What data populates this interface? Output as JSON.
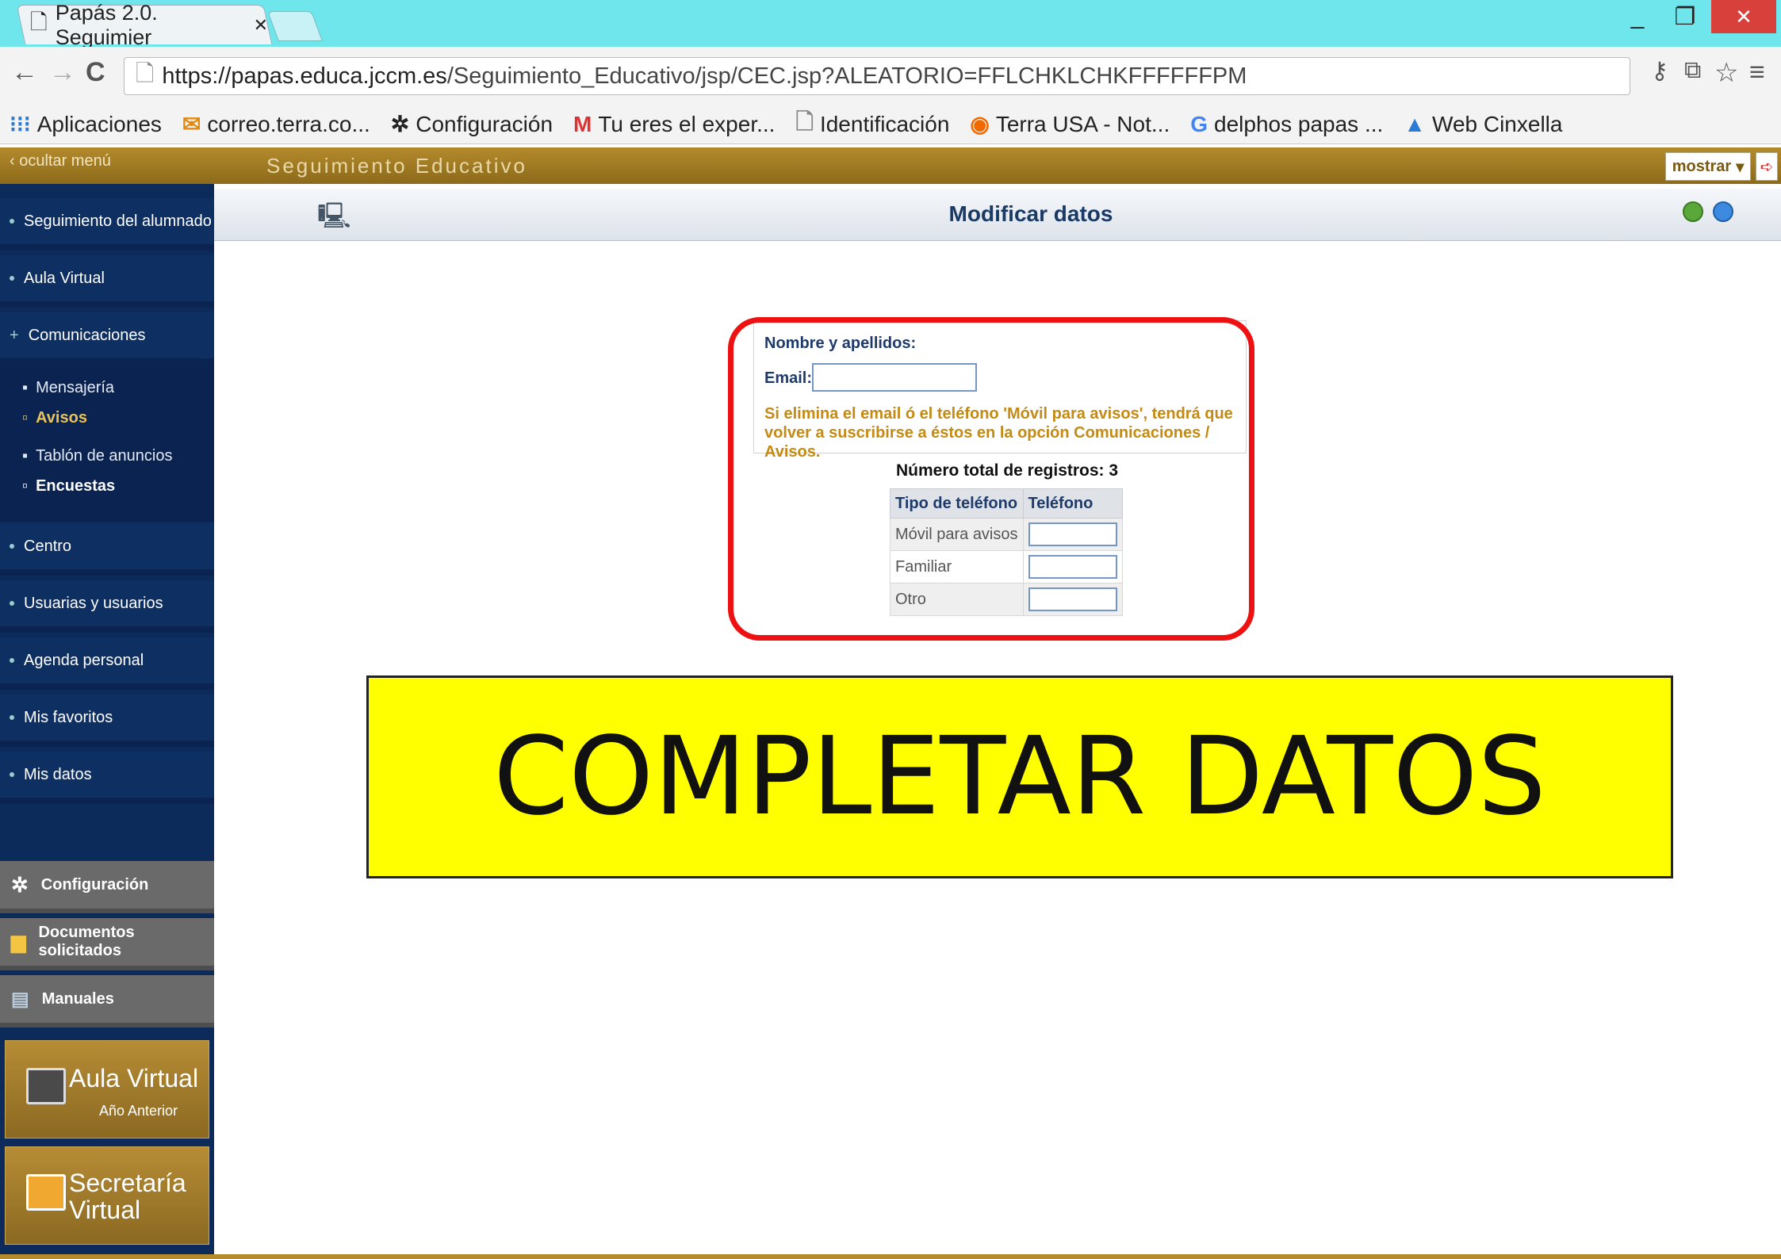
{
  "browser": {
    "tab_title": "Papás 2.0. Seguimier",
    "url_host": "https://papas.educa.jccm.es",
    "url_path": "/Seguimiento_Educativo/jsp/CEC.jsp?ALEATORIO=FFLCHKLCHKFFFFFFPM",
    "bookmarks": [
      "Aplicaciones",
      "correo.terra.co...",
      "Configuración",
      "Tu eres el exper...",
      "Identificación",
      "Terra USA - Not...",
      "delphos papas ...",
      "Web Cinxella"
    ],
    "icons": {
      "tab": "page-icon",
      "back": "back-arrow-icon",
      "forward": "forward-arrow-icon",
      "reload": "reload-icon",
      "star": "star-icon",
      "menu": "hamburger-icon"
    }
  },
  "app": {
    "hide_menu": "ocultar menú",
    "title": "Seguimiento Educativo",
    "show_button": "mostrar"
  },
  "sidebar": {
    "items": [
      "Seguimiento del alumnado",
      "Aula Virtual",
      "Comunicaciones",
      "Centro",
      "Usuarias y usuarios",
      "Agenda personal",
      "Mis favoritos",
      "Mis datos"
    ],
    "sub_items": [
      "Mensajería",
      "Avisos",
      "Tablón de anuncios",
      "Encuestas"
    ],
    "grey_items": [
      "Configuración",
      "Documentos solicitados",
      "Manuales"
    ],
    "promo1": {
      "title": "Aula Virtual",
      "sub": "Año Anterior"
    },
    "promo2": {
      "title_line1": "Secretaría",
      "title_line2": "Virtual"
    }
  },
  "main": {
    "title": "Modificar datos",
    "form": {
      "name_label": "Nombre y apellidos:",
      "email_label": "Email:",
      "email_value": "",
      "warning": "Si elimina el email ó el teléfono 'Móvil para avisos', tendrá que volver a suscribirse a éstos en la opción Comunicaciones / Avisos.",
      "total_records": "Número total de registros: 3",
      "phone_headers": [
        "Tipo de teléfono",
        "Teléfono"
      ],
      "phone_rows": [
        "Móvil para avisos",
        "Familiar",
        "Otro"
      ]
    },
    "banner": "COMPLETAR DATOS"
  },
  "colors": {
    "sidebar": "#0e2f62",
    "gold": "#b48a2c",
    "highlight": "#ee1111",
    "banner": "#ffff00"
  }
}
